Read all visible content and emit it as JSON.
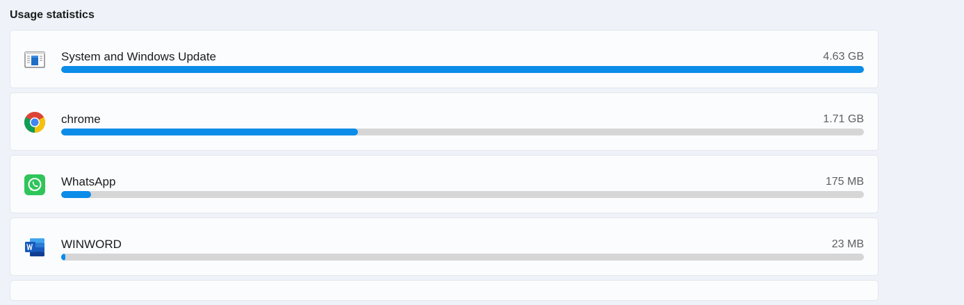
{
  "section": {
    "title": "Usage statistics"
  },
  "accent_color": "#0a8ce8",
  "items": [
    {
      "name": "System and Windows Update",
      "size": "4.63 GB",
      "fraction": 1.0,
      "icon": "windows-system-icon"
    },
    {
      "name": "chrome",
      "size": "1.71 GB",
      "fraction": 0.37,
      "icon": "chrome-icon"
    },
    {
      "name": "WhatsApp",
      "size": "175 MB",
      "fraction": 0.037,
      "icon": "whatsapp-icon"
    },
    {
      "name": "WINWORD",
      "size": "23 MB",
      "fraction": 0.005,
      "icon": "word-icon"
    }
  ]
}
